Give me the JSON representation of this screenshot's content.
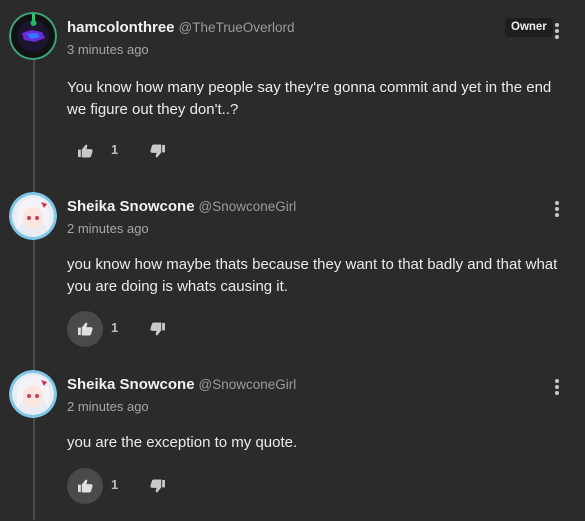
{
  "comments": [
    {
      "author": "hamcolonthree",
      "handle": "@TheTrueOverlord",
      "badge": "Owner",
      "time": "3 minutes ago",
      "text": "You know how many people say they're gonna commit and yet in the end we figure out they don't..?",
      "likes": "1"
    },
    {
      "author": "Sheika Snowcone",
      "handle": "@SnowconeGirl",
      "time": "2 minutes ago",
      "text": "you know how maybe thats because they want to that badly and that what you are doing is whats causing it.",
      "likes": "1"
    },
    {
      "author": "Sheika Snowcone",
      "handle": "@SnowconeGirl",
      "time": "2 minutes ago",
      "text": "you are the exception to my quote.",
      "likes": "1"
    }
  ],
  "icons": {
    "like": "thumbs-up-icon",
    "dislike": "thumbs-down-icon",
    "more": "more-vertical-icon"
  },
  "colors": {
    "background": "#2b2b2b",
    "badge_bg": "#1e1e1e",
    "like_filled_bg": "#4a4a4a"
  }
}
